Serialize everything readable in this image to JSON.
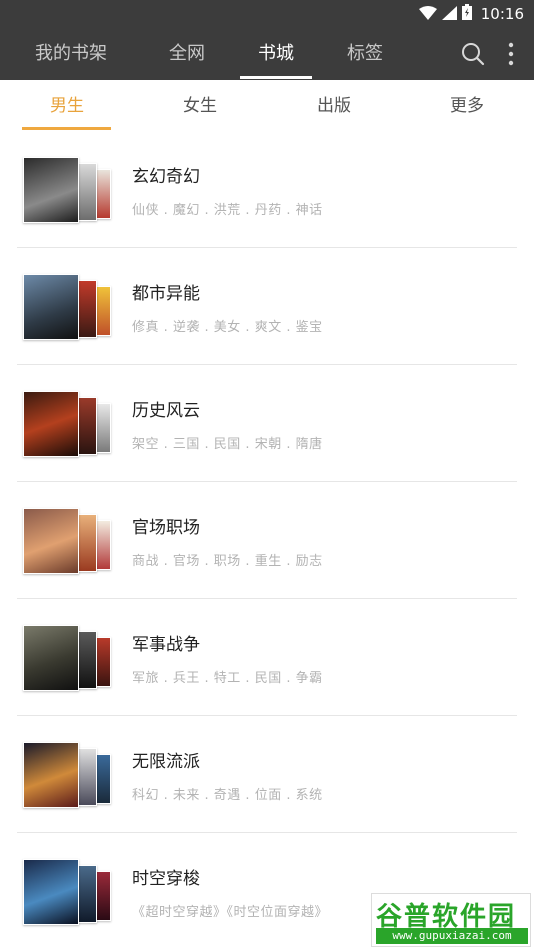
{
  "status": {
    "time": "10:16"
  },
  "topbar": {
    "tabs": [
      {
        "label": "我的书架"
      },
      {
        "label": "全网"
      },
      {
        "label": "书城"
      },
      {
        "label": "标签"
      }
    ],
    "active_tab": "书城"
  },
  "subtabs": {
    "items": [
      {
        "label": "男生"
      },
      {
        "label": "女生"
      },
      {
        "label": "出版"
      },
      {
        "label": "更多"
      }
    ],
    "active": "男生",
    "accent_color": "#efa83f"
  },
  "categories": [
    {
      "title": "玄幻奇幻",
      "tags": "仙侠 . 魔幻 . 洪荒 . 丹药 . 神话"
    },
    {
      "title": "都市异能",
      "tags": "修真 . 逆袭 . 美女 . 爽文 . 鉴宝"
    },
    {
      "title": "历史风云",
      "tags": "架空 . 三国 . 民国 . 宋朝 . 隋唐"
    },
    {
      "title": "官场职场",
      "tags": "商战 . 官场 . 职场 . 重生 . 励志"
    },
    {
      "title": "军事战争",
      "tags": "军旅 . 兵王 . 特工 . 民国 . 争霸"
    },
    {
      "title": "无限流派",
      "tags": "科幻 . 未来 . 奇遇 . 位面 . 系统"
    },
    {
      "title": "时空穿梭",
      "tags": "《超时空穿越》《时空位面穿越》"
    }
  ],
  "watermark": {
    "brand": "谷普软件园",
    "url": "www.gupuxiazai.com"
  }
}
